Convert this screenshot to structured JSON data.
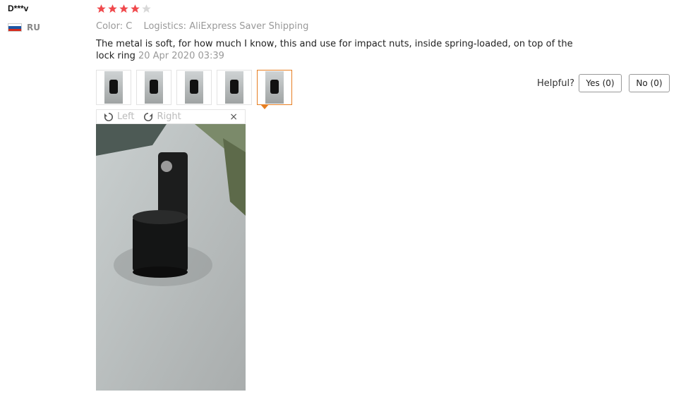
{
  "review": {
    "user": "D***v",
    "country": "RU",
    "rating": 4,
    "rating_max": 5,
    "color_label": "Color:",
    "color_value": "C",
    "logistics_label": "Logistics:",
    "logistics_value": "AliExpress Saver Shipping",
    "text": "The metal is soft, for how much I know, this and use for impact nuts, inside spring-loaded, on top of the lock ring",
    "date": "20 Apr 2020 03:39",
    "thumbnails": [
      "photo-1",
      "photo-2",
      "photo-3",
      "photo-4",
      "photo-5"
    ],
    "active_thumbnail": 5
  },
  "viewer": {
    "rotate_left": "Left",
    "rotate_right": "Right",
    "close": "×"
  },
  "helpful": {
    "label": "Helpful?",
    "yes": "Yes (0)",
    "no": "No (0)"
  },
  "colors": {
    "star_on": "#f0494c",
    "star_off": "#d8d8d8",
    "accent": "#e67e22"
  }
}
